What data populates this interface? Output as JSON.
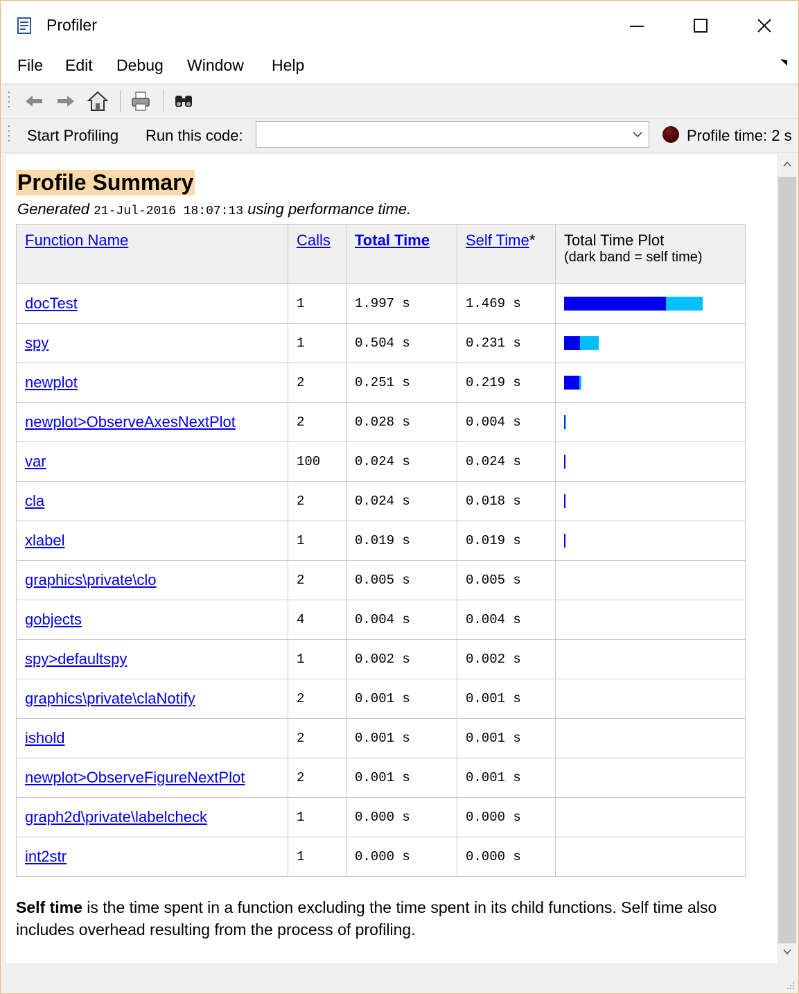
{
  "window": {
    "title": "Profiler"
  },
  "menu": [
    "File",
    "Edit",
    "Debug",
    "Window",
    "Help"
  ],
  "toolbar": {
    "icons": [
      "back-icon",
      "forward-icon",
      "home-icon",
      "print-icon",
      "find-icon"
    ]
  },
  "run_bar": {
    "start_label": "Start Profiling",
    "run_label": "Run this code:",
    "run_value": "",
    "status_text": "Profile time: 2 s"
  },
  "summary": {
    "title": "Profile Summary",
    "generated_prefix": "Generated ",
    "generated_date": "21-Jul-2016 18:07:13",
    "generated_suffix": " using performance time.",
    "headers": {
      "name": "Function Name",
      "calls": "Calls",
      "total": "Total Time",
      "self": "Self Time",
      "self_suffix": "*",
      "plot_title": "Total Time Plot",
      "plot_sub": "(dark band = self time)"
    },
    "rows": [
      {
        "name": "docTest",
        "calls": "1",
        "total": "1.997 s",
        "self": "1.469 s",
        "total_v": 1.997,
        "self_v": 1.469
      },
      {
        "name": "spy",
        "calls": "1",
        "total": "0.504 s",
        "self": "0.231 s",
        "total_v": 0.504,
        "self_v": 0.231
      },
      {
        "name": "newplot",
        "calls": "2",
        "total": "0.251 s",
        "self": "0.219 s",
        "total_v": 0.251,
        "self_v": 0.219
      },
      {
        "name": "newplot>ObserveAxesNextPlot",
        "calls": "2",
        "total": "0.028 s",
        "self": "0.004 s",
        "total_v": 0.028,
        "self_v": 0.004
      },
      {
        "name": "var",
        "calls": "100",
        "total": "0.024 s",
        "self": "0.024 s",
        "total_v": 0.024,
        "self_v": 0.024
      },
      {
        "name": "cla",
        "calls": "2",
        "total": "0.024 s",
        "self": "0.018 s",
        "total_v": 0.024,
        "self_v": 0.018
      },
      {
        "name": "xlabel",
        "calls": "1",
        "total": "0.019 s",
        "self": "0.019 s",
        "total_v": 0.019,
        "self_v": 0.019
      },
      {
        "name": "graphics\\private\\clo",
        "calls": "2",
        "total": "0.005 s",
        "self": "0.005 s",
        "total_v": 0.005,
        "self_v": 0.005
      },
      {
        "name": "gobjects",
        "calls": "4",
        "total": "0.004 s",
        "self": "0.004 s",
        "total_v": 0.004,
        "self_v": 0.004
      },
      {
        "name": "spy>defaultspy",
        "calls": "1",
        "total": "0.002 s",
        "self": "0.002 s",
        "total_v": 0.002,
        "self_v": 0.002
      },
      {
        "name": "graphics\\private\\claNotify",
        "calls": "2",
        "total": "0.001 s",
        "self": "0.001 s",
        "total_v": 0.001,
        "self_v": 0.001
      },
      {
        "name": "ishold",
        "calls": "2",
        "total": "0.001 s",
        "self": "0.001 s",
        "total_v": 0.001,
        "self_v": 0.001
      },
      {
        "name": "newplot>ObserveFigureNextPlot",
        "calls": "2",
        "total": "0.001 s",
        "self": "0.001 s",
        "total_v": 0.001,
        "self_v": 0.001
      },
      {
        "name": "graph2d\\private\\labelcheck",
        "calls": "1",
        "total": "0.000 s",
        "self": "0.000 s",
        "total_v": 0.0,
        "self_v": 0.0
      },
      {
        "name": "int2str",
        "calls": "1",
        "total": "0.000 s",
        "self": "0.000 s",
        "total_v": 0.0,
        "self_v": 0.0
      }
    ],
    "note_bold": "Self time",
    "note_text": " is the time spent in a function excluding the time spent in its child functions. Self time also includes overhead resulting from the process of profiling."
  },
  "colors": {
    "self_bar": "#0000f0",
    "total_bar": "#00bfff",
    "title_highlight": "#fcd9a8",
    "link": "#0000ee"
  }
}
